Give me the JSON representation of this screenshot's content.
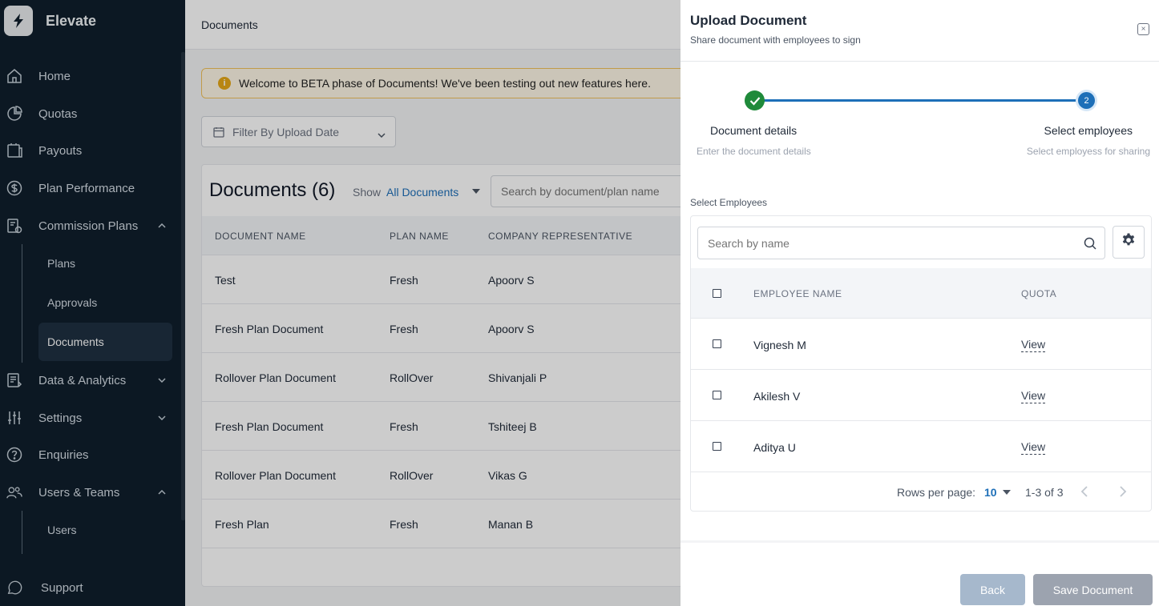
{
  "sidebar": {
    "brand": "Elevate",
    "items": [
      {
        "label": "Home",
        "icon": "home-icon"
      },
      {
        "label": "Quotas",
        "icon": "pie-chart-icon"
      },
      {
        "label": "Payouts",
        "icon": "payouts-icon"
      },
      {
        "label": "Plan Performance",
        "icon": "dollar-icon"
      },
      {
        "label": "Commission Plans",
        "icon": "commission-icon",
        "expanded": true
      },
      {
        "label": "Data & Analytics",
        "icon": "data-icon",
        "expanded": false
      },
      {
        "label": "Settings",
        "icon": "sliders-icon",
        "expanded": false
      },
      {
        "label": "Enquiries",
        "icon": "help-icon"
      },
      {
        "label": "Users & Teams",
        "icon": "users-icon",
        "expanded": true
      },
      {
        "label": "Support",
        "icon": "chat-icon"
      }
    ],
    "commission_sub": [
      "Plans",
      "Approvals",
      "Documents"
    ],
    "active_sub": "Documents",
    "users_sub": [
      "Users"
    ]
  },
  "main": {
    "breadcrumb": "Documents",
    "banner": "Welcome to BETA phase of Documents! We've been testing out new features here.",
    "filter_placeholder": "Filter By Upload Date",
    "documents_title": "Documents (6)",
    "show_label": "Show",
    "show_value": "All Documents",
    "search_placeholder": "Search by document/plan name",
    "columns": [
      "DOCUMENT NAME",
      "PLAN NAME",
      "COMPANY REPRESENTATIVE"
    ],
    "rows": [
      {
        "doc": "Test",
        "plan": "Fresh",
        "rep": "Apoorv S"
      },
      {
        "doc": "Fresh Plan Document",
        "plan": "Fresh",
        "rep": "Apoorv S"
      },
      {
        "doc": "Rollover Plan Document",
        "plan": "RollOver",
        "rep": "Shivanjali P"
      },
      {
        "doc": "Fresh Plan Document",
        "plan": "Fresh",
        "rep": "Tshiteej B"
      },
      {
        "doc": "Rollover Plan Document",
        "plan": "RollOver",
        "rep": "Vikas G"
      },
      {
        "doc": "Fresh Plan",
        "plan": "Fresh",
        "rep": "Manan B"
      }
    ]
  },
  "drawer": {
    "title": "Upload Document",
    "subtitle": "Share document with employees to sign",
    "steps": [
      {
        "title": "Document details",
        "desc": "Enter the document details",
        "status": "complete"
      },
      {
        "number": "2",
        "title": "Select employees",
        "desc": "Select employess for sharing",
        "status": "active"
      }
    ],
    "select_label": "Select Employees",
    "search_placeholder": "Search by name",
    "columns": [
      "EMPLOYEE NAME",
      "QUOTA"
    ],
    "employees": [
      {
        "name": "Vignesh M",
        "quota": "View"
      },
      {
        "name": "Akilesh V",
        "quota": "View"
      },
      {
        "name": "Aditya U",
        "quota": "View"
      }
    ],
    "pager": {
      "label": "Rows per page:",
      "value": "10",
      "range": "1-3 of 3"
    },
    "back_label": "Back",
    "save_label": "Save Document"
  },
  "colors": {
    "sidebar_bg": "#0f1f2c",
    "accent": "#1d6fb8",
    "success": "#1f8a3a"
  }
}
